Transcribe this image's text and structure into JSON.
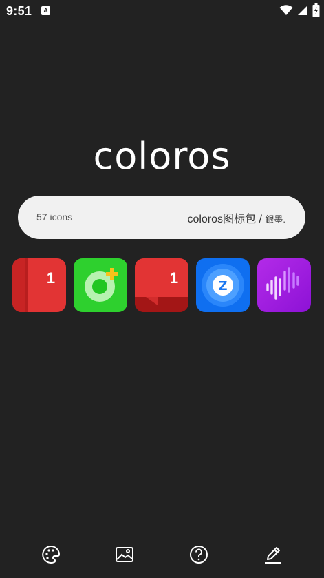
{
  "status_bar": {
    "time": "9:51",
    "notification_badge": "A",
    "icons": [
      "wifi-icon",
      "signal-icon",
      "battery-charging-icon"
    ]
  },
  "logo": {
    "text": "coloros"
  },
  "info_pill": {
    "count_label": "57 icons",
    "pack_name": "coloros图标包",
    "separator": " / ",
    "author": "銀墨."
  },
  "preview_icons": [
    {
      "name": "calendar-app-icon",
      "badge": "1",
      "color": "#e53535"
    },
    {
      "name": "phone-dialer-app-icon",
      "color": "#2fcf2f"
    },
    {
      "name": "messages-app-icon",
      "badge": "1",
      "color": "#e53535"
    },
    {
      "name": "z-app-icon",
      "glyph": "Z",
      "color": "#1877f2"
    },
    {
      "name": "sound-recorder-app-icon",
      "color": "#a01de0"
    }
  ],
  "bottom_nav": [
    {
      "name": "theme-palette-icon"
    },
    {
      "name": "wallpaper-icon"
    },
    {
      "name": "help-icon"
    },
    {
      "name": "edit-icon"
    }
  ]
}
